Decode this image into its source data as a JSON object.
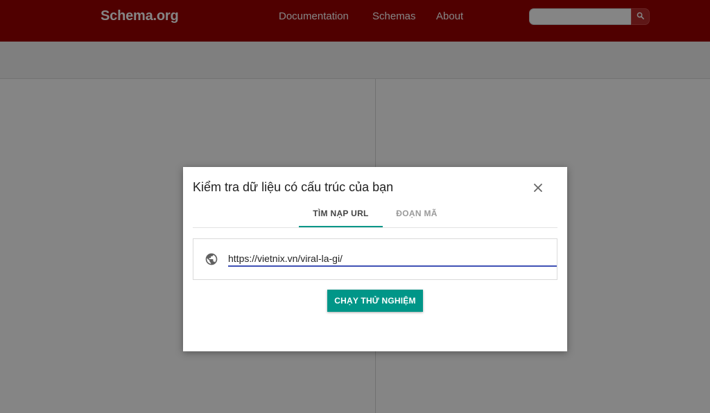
{
  "site": {
    "logo": "Schema.org",
    "nav": [
      "Documentation",
      "Schemas",
      "About"
    ],
    "search": {
      "placeholder": "",
      "value": ""
    },
    "icons": {
      "search": "search-icon"
    },
    "colors": {
      "header": "#990000",
      "accent": "#009688",
      "input_underline": "#3f51b5"
    }
  },
  "dialog": {
    "title": "Kiểm tra dữ liệu có cấu trúc của bạn",
    "tabs": [
      {
        "label": "TÌM NẠP URL",
        "active": true
      },
      {
        "label": "ĐOẠN MÃ",
        "active": false
      }
    ],
    "url_input": {
      "value": "https://vietnix.vn/viral-la-gi/"
    },
    "run_button": "CHẠY THỬ NGHIỆM",
    "icons": {
      "close": "close-icon",
      "globe": "globe-icon"
    }
  }
}
